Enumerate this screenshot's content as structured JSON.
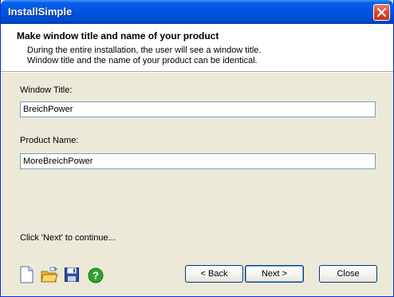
{
  "window": {
    "title": "InstallSimple"
  },
  "header": {
    "title": "Make window title and name of your product",
    "description": [
      "During the entire installation, the user will see a window title.",
      "Window title and the name of your product can be identical."
    ]
  },
  "form": {
    "window_title_label": "Window Title:",
    "window_title_value": "BreichPower",
    "product_name_label": "Product Name:",
    "product_name_value": "MoreBreichPower"
  },
  "hint": "Click 'Next' to continue...",
  "toolbar_icons": [
    "new-file-icon",
    "open-folder-icon",
    "save-disk-icon",
    "help-icon"
  ],
  "buttons": {
    "back": "< Back",
    "next": "Next >",
    "close": "Close"
  },
  "colors": {
    "titlebar": "#0054e3",
    "window_bg": "#ece9d8",
    "field_border": "#7f9db9",
    "close_button": "#d84a2b"
  }
}
